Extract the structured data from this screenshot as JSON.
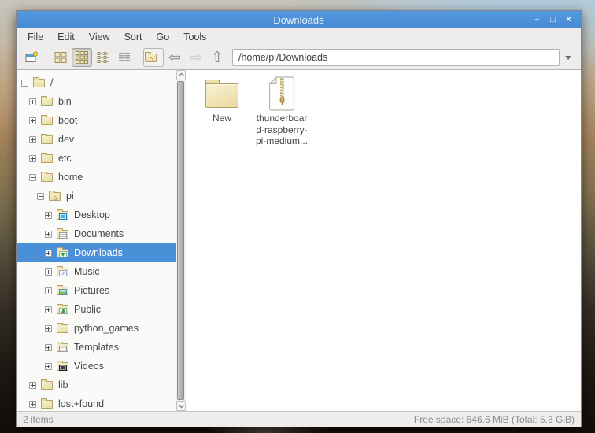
{
  "window": {
    "title": "Downloads",
    "controls": [
      {
        "name": "minimize",
        "glyph": "–"
      },
      {
        "name": "maximize",
        "glyph": "□"
      },
      {
        "name": "close",
        "glyph": "×"
      }
    ]
  },
  "menu": {
    "items": [
      "File",
      "Edit",
      "View",
      "Sort",
      "Go",
      "Tools"
    ]
  },
  "toolbar": {
    "address_value": "/home/pi/Downloads",
    "buttons": [
      {
        "icon": "new-window-icon"
      },
      {
        "icon": "icon-view-icon"
      },
      {
        "icon": "thumbnail-view-icon",
        "state": "active"
      },
      {
        "icon": "compact-view-icon"
      },
      {
        "icon": "detailed-list-view-icon"
      },
      {
        "icon": "home-folder-icon"
      },
      {
        "icon": "back-arrow-icon",
        "glyph": "⇦"
      },
      {
        "icon": "forward-arrow-icon",
        "glyph": "⇨",
        "state": "disabled"
      },
      {
        "icon": "up-arrow-icon",
        "glyph": "⇧"
      }
    ]
  },
  "tree": {
    "items": [
      {
        "label": "/",
        "level": 0,
        "expander": "minus",
        "icon": "folder-icon"
      },
      {
        "label": "bin",
        "level": 1,
        "expander": "plus",
        "icon": "folder-icon"
      },
      {
        "label": "boot",
        "level": 1,
        "expander": "plus",
        "icon": "folder-icon"
      },
      {
        "label": "dev",
        "level": 1,
        "expander": "plus",
        "icon": "folder-icon"
      },
      {
        "label": "etc",
        "level": 1,
        "expander": "plus",
        "icon": "folder-icon"
      },
      {
        "label": "home",
        "level": 1,
        "expander": "minus",
        "icon": "folder-icon"
      },
      {
        "label": "pi",
        "level": 2,
        "expander": "minus",
        "icon": "home-folder-icon"
      },
      {
        "label": "Desktop",
        "level": 3,
        "expander": "plus",
        "icon": "desktop-folder-icon"
      },
      {
        "label": "Documents",
        "level": 3,
        "expander": "plus",
        "icon": "documents-folder-icon"
      },
      {
        "label": "Downloads",
        "level": 3,
        "expander": "plus",
        "icon": "downloads-folder-icon",
        "selected": true
      },
      {
        "label": "Music",
        "level": 3,
        "expander": "plus",
        "icon": "music-folder-icon"
      },
      {
        "label": "Pictures",
        "level": 3,
        "expander": "plus",
        "icon": "pictures-folder-icon"
      },
      {
        "label": "Public",
        "level": 3,
        "expander": "plus",
        "icon": "public-folder-icon"
      },
      {
        "label": "python_games",
        "level": 3,
        "expander": "plus",
        "icon": "folder-icon"
      },
      {
        "label": "Templates",
        "level": 3,
        "expander": "plus",
        "icon": "templates-folder-icon"
      },
      {
        "label": "Videos",
        "level": 3,
        "expander": "plus",
        "icon": "videos-folder-icon"
      },
      {
        "label": "lib",
        "level": 1,
        "expander": "plus",
        "icon": "folder-icon"
      },
      {
        "label": "lost+found",
        "level": 1,
        "expander": "plus",
        "icon": "folder-icon"
      }
    ]
  },
  "files": [
    {
      "icon": "folder-icon",
      "lines": [
        "New"
      ]
    },
    {
      "icon": "zip-archive-icon",
      "lines": [
        "thunderboar",
        "d-raspberry-",
        "pi-medium..."
      ]
    }
  ],
  "status": {
    "left": "2 items",
    "right": "Free space: 646.6 MiB (Total: 5.3 GiB)"
  },
  "colors": {
    "titlebar": "#4a8edb",
    "selection": "#4a90d9",
    "folder": "#f2e7bd",
    "chrome_bg": "#efedeb"
  }
}
